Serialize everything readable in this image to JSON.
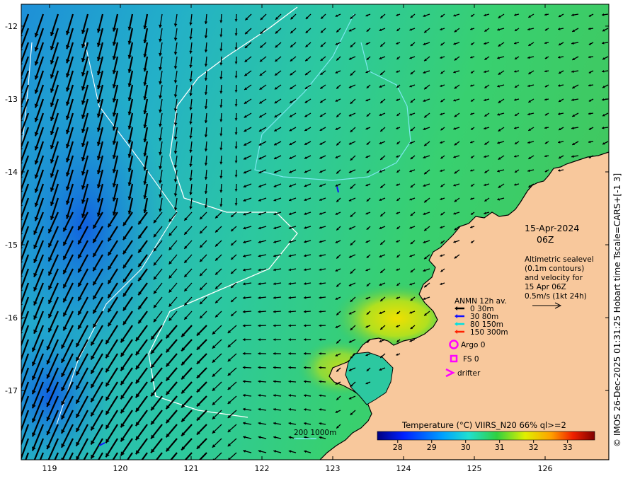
{
  "map": {
    "x_axis_ticks": [
      "119",
      "120",
      "121",
      "122",
      "123",
      "124",
      "125",
      "126"
    ],
    "y_axis_ticks": [
      "-12",
      "-13",
      "-14",
      "-15",
      "-16",
      "-17"
    ],
    "lon_range": [
      118.6,
      126.9
    ],
    "lat_range": [
      -17.95,
      -11.7
    ]
  },
  "title_block": {
    "date": "15-Apr-2024",
    "time": "06Z"
  },
  "altimetry_note": {
    "line1": "Altimetric sealevel",
    "line2": "(0.1m contours)",
    "line3": "and velocity for",
    "line4": "15 Apr 06Z",
    "line5": "0.5m/s (1kt 24h)"
  },
  "anmn_legend": {
    "title": "ANMN 12h av.",
    "items": [
      {
        "label": "0 30m",
        "color": "#000000"
      },
      {
        "label": "30 80m",
        "color": "#1010ff"
      },
      {
        "label": "80 150m",
        "color": "#00e0e0"
      },
      {
        "label": "150 300m",
        "color": "#ff2000"
      }
    ]
  },
  "obs_legend": {
    "argo": "Argo 0",
    "fs": "FS 0",
    "drifter": "drifter",
    "color": "#ff00ff"
  },
  "bathy_label": "200  1000m",
  "colorbar": {
    "title": "Temperature (°C) VIIRS_N20 66% ql>=2",
    "ticks": [
      "28",
      "29",
      "30",
      "31",
      "32",
      "33"
    ],
    "range": [
      27.4,
      33.8
    ]
  },
  "credit": "© IMOS 26-Dec-2025 01:31:25 Hobart time Tscale=CARS+[-1 3]",
  "colors": {
    "land": "#f8c89c",
    "ocean_mid": "#27c8a8"
  }
}
